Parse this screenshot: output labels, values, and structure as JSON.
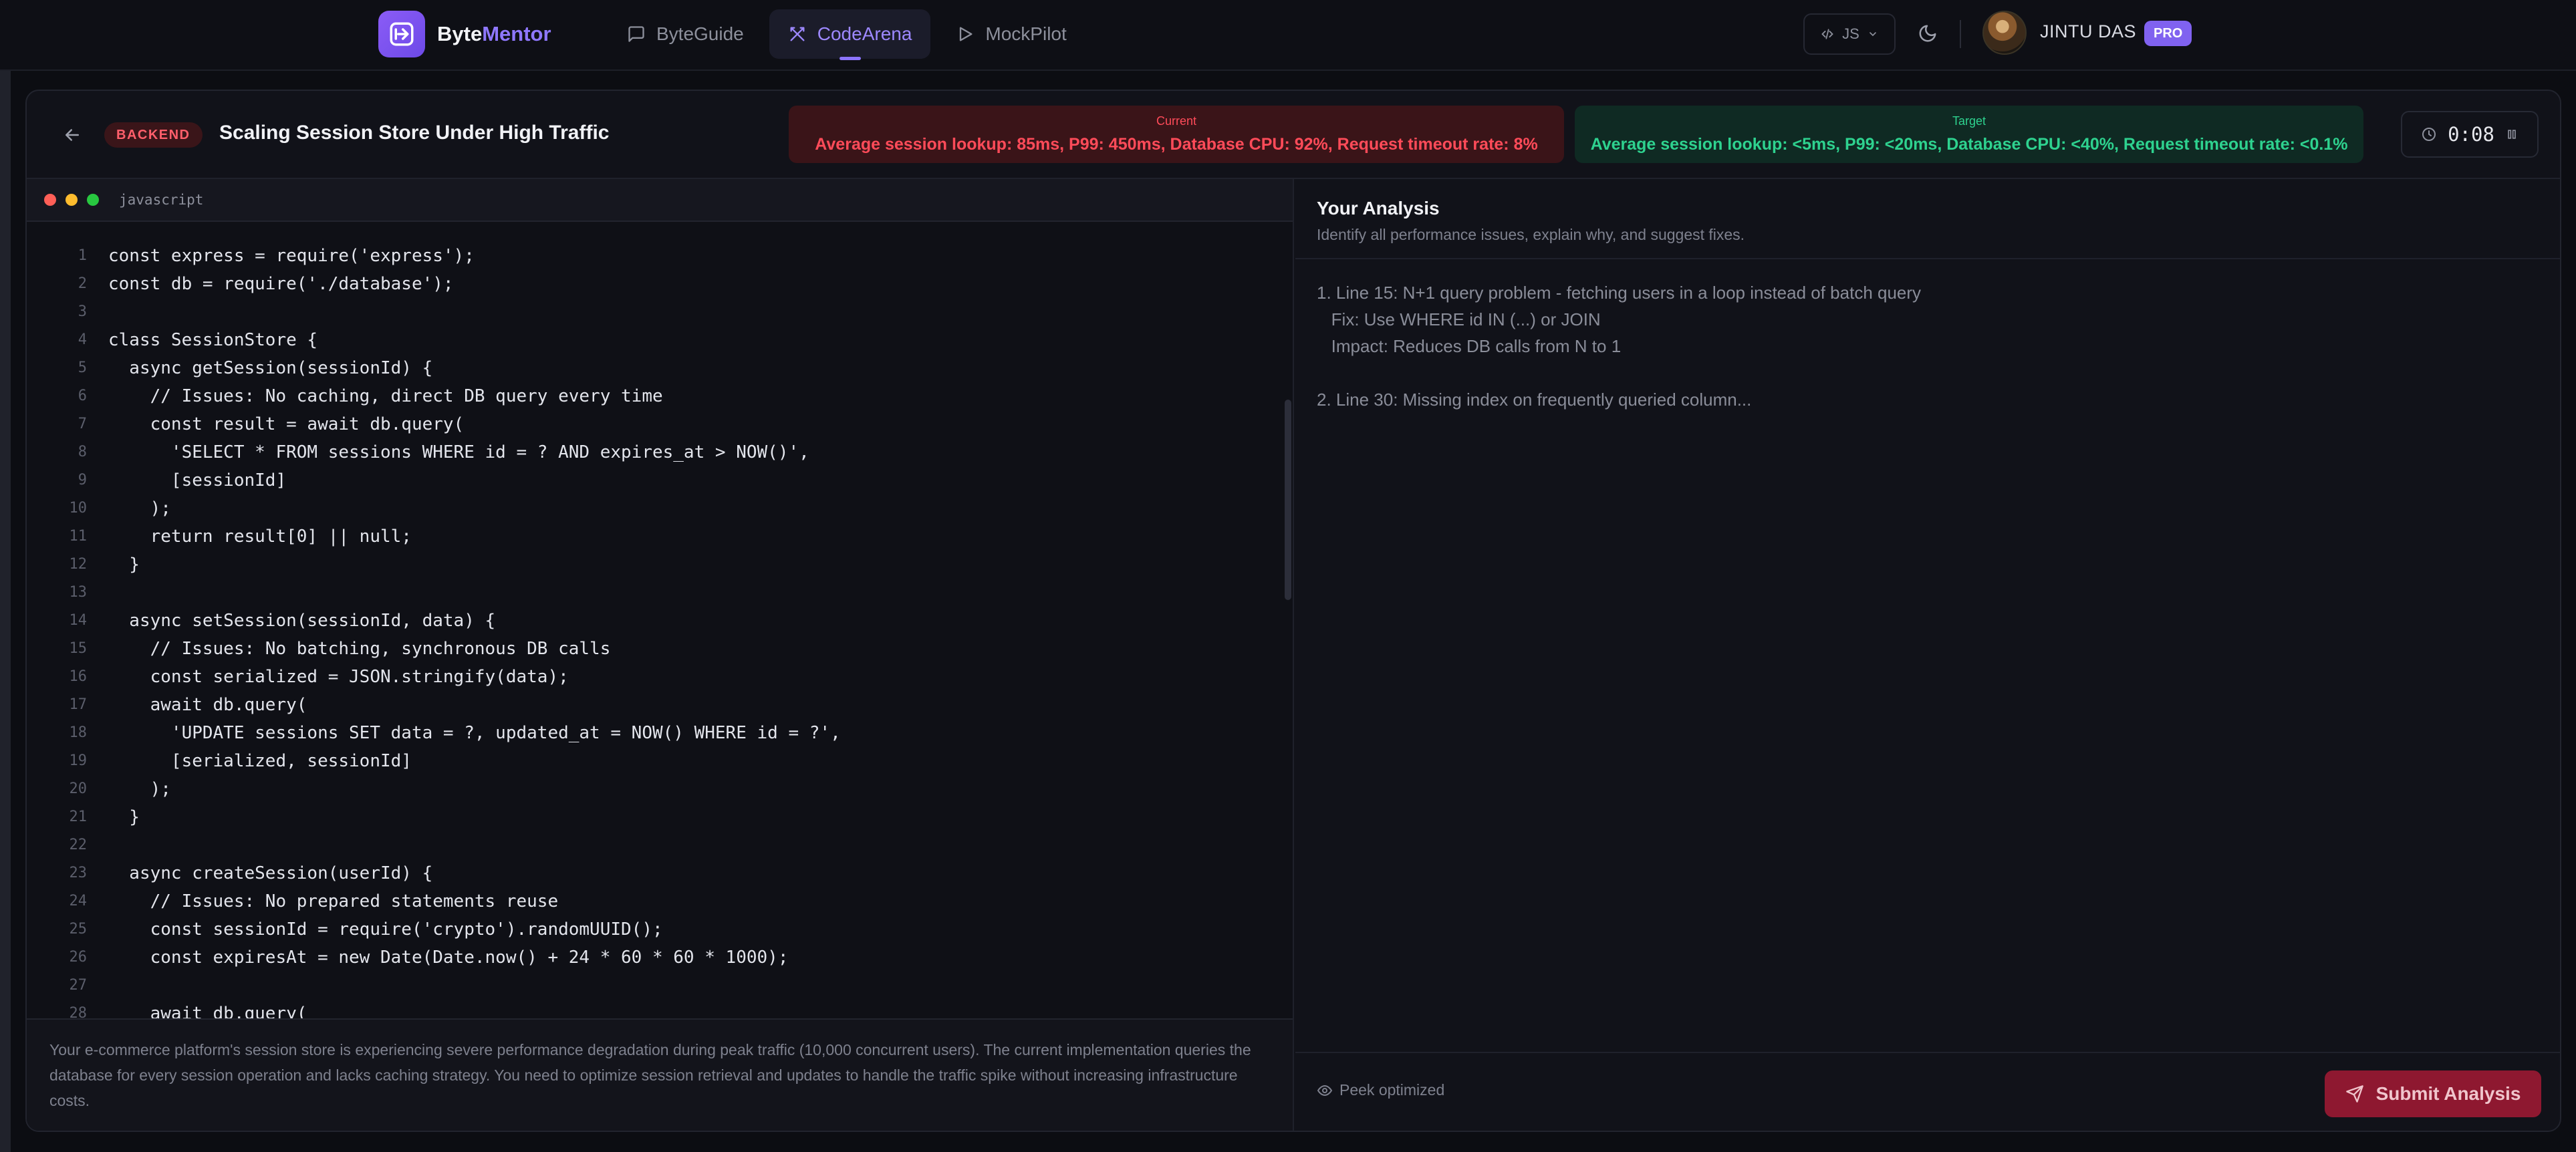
{
  "brand": {
    "name_prefix": "Byte",
    "name_suffix": "Mentor"
  },
  "nav": {
    "items": [
      {
        "label": "ByteGuide",
        "icon": "message-square-icon",
        "active": false
      },
      {
        "label": "CodeArena",
        "icon": "swords-icon",
        "active": true
      },
      {
        "label": "MockPilot",
        "icon": "play-icon",
        "active": false
      }
    ]
  },
  "language_selector": {
    "value": "JS",
    "icon": "code-icon"
  },
  "theme_toggle": {
    "icon": "moon-icon"
  },
  "user": {
    "name": "JINTU DAS",
    "badge": "PRO"
  },
  "challenge": {
    "category": "BACKEND",
    "title": "Scaling Session Store Under High Traffic",
    "current": {
      "label": "Current",
      "value": "Average session lookup: 85ms, P99: 450ms, Database CPU: 92%, Request timeout rate: 8%"
    },
    "target": {
      "label": "Target",
      "value": "Average session lookup: <5ms, P99: <20ms, Database CPU: <40%, Request timeout rate: <0.1%"
    },
    "timer": "0:08"
  },
  "editor": {
    "language": "javascript",
    "lines": [
      "const express = require('express');",
      "const db = require('./database');",
      "",
      "class SessionStore {",
      "  async getSession(sessionId) {",
      "    // Issues: No caching, direct DB query every time",
      "    const result = await db.query(",
      "      'SELECT * FROM sessions WHERE id = ? AND expires_at > NOW()',",
      "      [sessionId]",
      "    );",
      "    return result[0] || null;",
      "  }",
      "",
      "  async setSession(sessionId, data) {",
      "    // Issues: No batching, synchronous DB calls",
      "    const serialized = JSON.stringify(data);",
      "    await db.query(",
      "      'UPDATE sessions SET data = ?, updated_at = NOW() WHERE id = ?',",
      "      [serialized, sessionId]",
      "    );",
      "  }",
      "",
      "  async createSession(userId) {",
      "    // Issues: No prepared statements reuse",
      "    const sessionId = require('crypto').randomUUID();",
      "    const expiresAt = new Date(Date.now() + 24 * 60 * 60 * 1000);",
      "",
      "    await db.query("
    ],
    "description": "Your e-commerce platform's session store is experiencing severe performance degradation during peak traffic (10,000 concurrent users). The current implementation queries the database for every session operation and lacks caching strategy. You need to optimize session retrieval and updates to handle the traffic spike without increasing infrastructure costs."
  },
  "analysis": {
    "title": "Your Analysis",
    "subtitle": "Identify all performance issues, explain why, and suggest fixes.",
    "placeholder": "1. Line 15: N+1 query problem - fetching users in a loop instead of batch query\n   Fix: Use WHERE id IN (...) or JOIN\n   Impact: Reduces DB calls from N to 1\n\n2. Line 30: Missing index on frequently queried column...",
    "peek_label": "Peek optimized",
    "submit_label": "Submit Analysis"
  },
  "colors": {
    "accent": "#8c74ff",
    "danger": "#ff4b59",
    "success": "#2ed28f",
    "submit": "#8e1830"
  }
}
